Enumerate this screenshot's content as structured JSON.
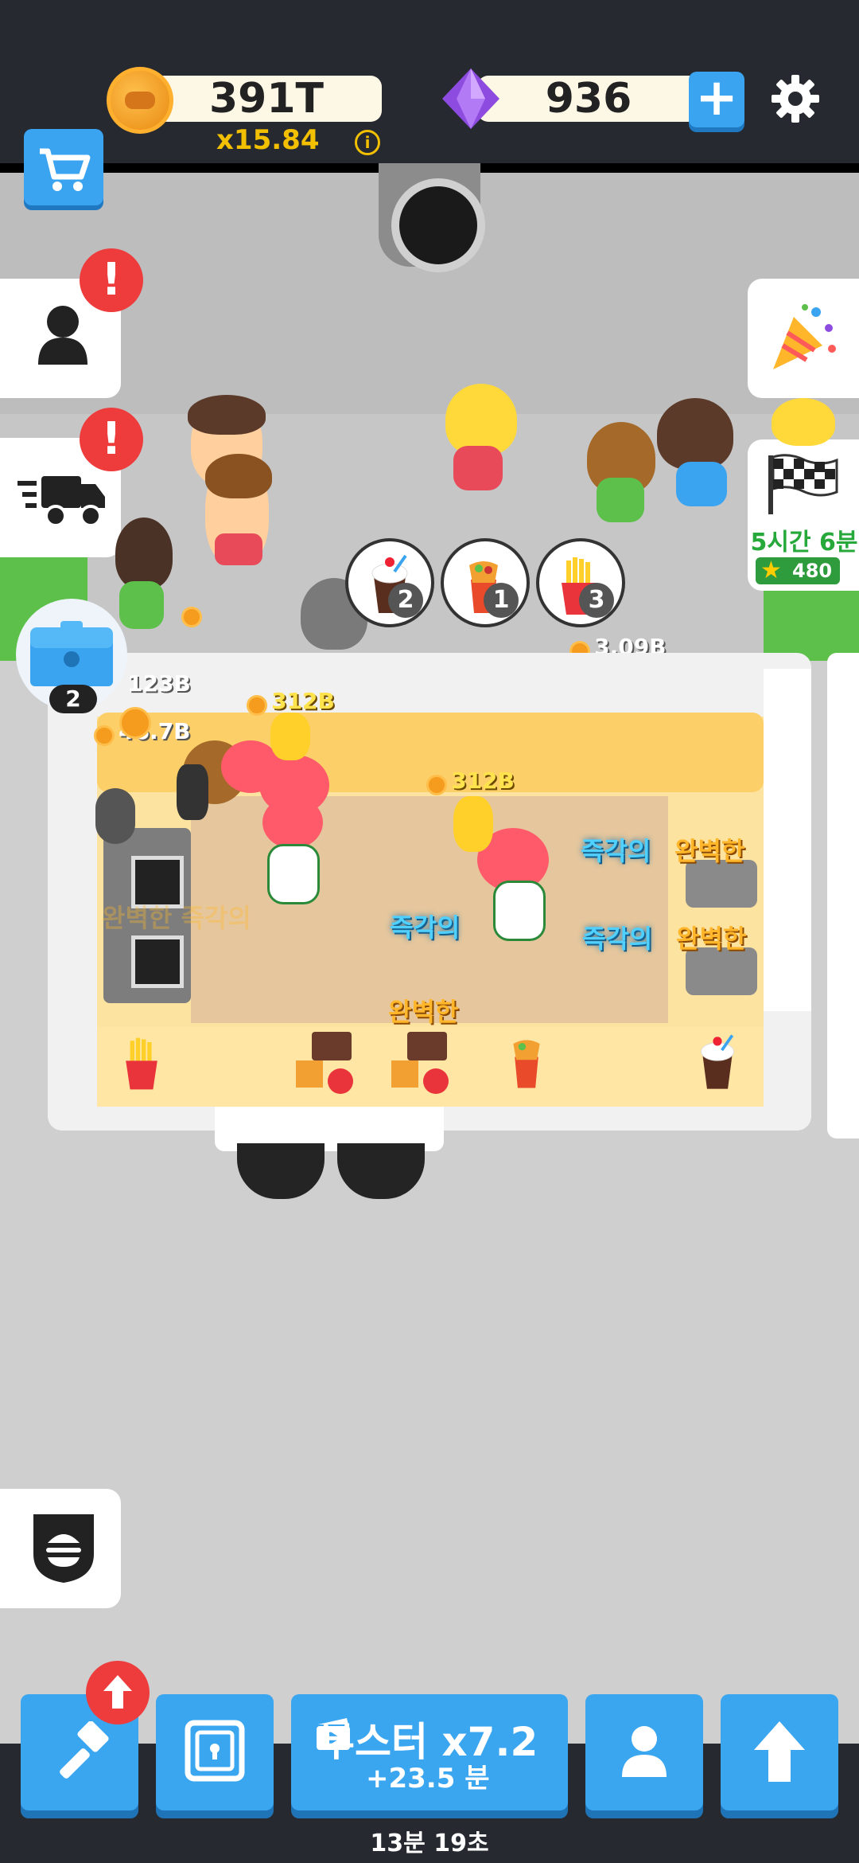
{
  "currency": {
    "coins": "391T",
    "multiplier": "x15.84",
    "gems": "936"
  },
  "event": {
    "countdown": "5시간 6분",
    "stars": "480"
  },
  "chest": {
    "count": "2"
  },
  "orders": [
    {
      "icon": "milkshake-icon",
      "count": "2"
    },
    {
      "icon": "wrap-icon",
      "count": "1"
    },
    {
      "icon": "fries-icon",
      "count": "3"
    }
  ],
  "earnings": {
    "order_value": "3.09B",
    "left_a": "123B",
    "left_b": "46.7B",
    "worker_a": "312B",
    "worker_b": "312B"
  },
  "station_labels": {
    "instant": "즉각의",
    "perfect": "완벽한",
    "faded": "완벽한 즉각의"
  },
  "booster": {
    "title": "부스터 x7.2",
    "subtitle": "+23.5 분"
  },
  "timer": "13분 19초",
  "colors": {
    "bar": "#262a30",
    "button": "#3ba6f0",
    "alert": "#ee3b3b",
    "event_green": "#27a83a"
  }
}
